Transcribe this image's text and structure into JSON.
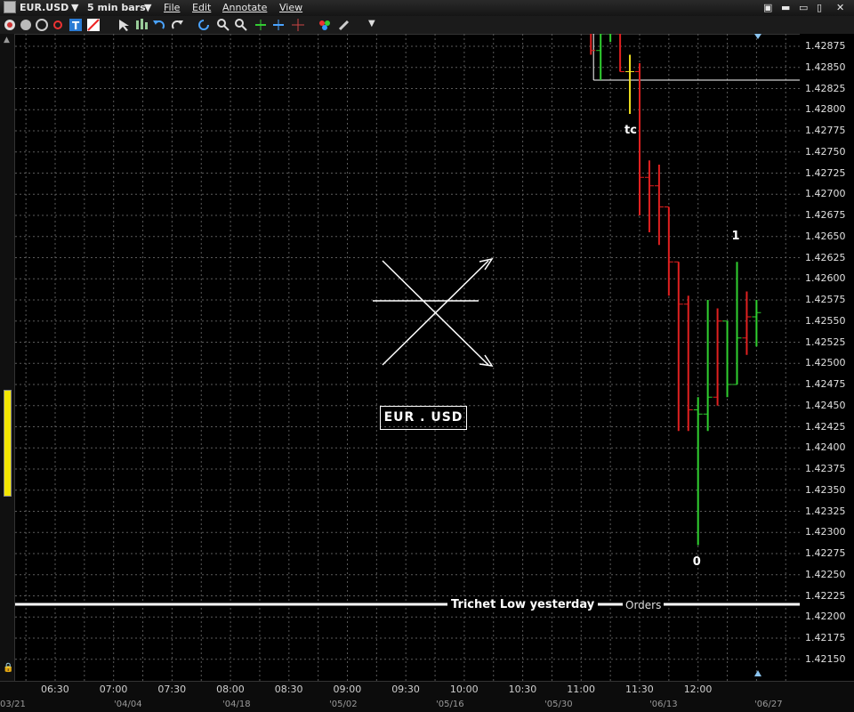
{
  "window": {
    "symbol": "EUR.USD",
    "bar_size": "5 min bars",
    "menus": [
      "File",
      "Edit",
      "Annotate",
      "View"
    ]
  },
  "chart_data": {
    "type": "bar",
    "ylim": [
      1.4214,
      1.42895
    ],
    "y_ticks": [
      "1.42875",
      "1.42850",
      "1.42825",
      "1.42800",
      "1.42775",
      "1.42750",
      "1.42725",
      "1.42700",
      "1.42675",
      "1.42650",
      "1.42625",
      "1.42600",
      "1.42575",
      "1.42550",
      "1.42525",
      "1.42500",
      "1.42475",
      "1.42450",
      "1.42425",
      "1.42400",
      "1.42375",
      "1.42350",
      "1.42325",
      "1.42300",
      "1.42275",
      "1.42250",
      "1.42225",
      "1.42200",
      "1.42175",
      "1.42150"
    ],
    "x_ticks": [
      "06:30",
      "07:00",
      "07:30",
      "08:00",
      "08:30",
      "09:00",
      "09:30",
      "10:00",
      "10:30",
      "11:00",
      "11:30",
      "12:00"
    ],
    "range_labels": [
      "03/21",
      "'04/04",
      "'04/18",
      "'05/02",
      "'05/16",
      "'05/30",
      "'06/13",
      "'06/27"
    ],
    "ohlc_bars": [
      {
        "time": "11:05",
        "open": 1.429,
        "high": 1.429,
        "low": 1.42865,
        "close": 1.4287,
        "color": "#e02020"
      },
      {
        "time": "11:10",
        "open": 1.4287,
        "high": 1.429,
        "low": 1.42835,
        "close": 1.4289,
        "color": "#30d030"
      },
      {
        "time": "11:15",
        "open": 1.4289,
        "high": 1.429,
        "low": 1.4288,
        "close": 1.42895,
        "color": "#30d030"
      },
      {
        "time": "11:20",
        "open": 1.4289,
        "high": 1.429,
        "low": 1.42845,
        "close": 1.42845,
        "color": "#e02020"
      },
      {
        "time": "11:25",
        "open": 1.42845,
        "high": 1.42865,
        "low": 1.42795,
        "close": 1.42845,
        "color": "#f0e020"
      },
      {
        "time": "11:30",
        "open": 1.42845,
        "high": 1.42855,
        "low": 1.42675,
        "close": 1.4272,
        "color": "#e02020"
      },
      {
        "time": "11:35",
        "open": 1.4272,
        "high": 1.4274,
        "low": 1.42655,
        "close": 1.4271,
        "color": "#e02020"
      },
      {
        "time": "11:40",
        "open": 1.4271,
        "high": 1.42735,
        "low": 1.4264,
        "close": 1.42685,
        "color": "#e02020"
      },
      {
        "time": "11:45",
        "open": 1.42685,
        "high": 1.4268,
        "low": 1.4258,
        "close": 1.4262,
        "color": "#e02020"
      },
      {
        "time": "11:50",
        "open": 1.4262,
        "high": 1.4258,
        "low": 1.4242,
        "close": 1.4257,
        "color": "#e02020"
      },
      {
        "time": "11:55",
        "open": 1.4257,
        "high": 1.4258,
        "low": 1.4242,
        "close": 1.42445,
        "color": "#e02020"
      },
      {
        "time": "12:00",
        "open": 1.42445,
        "high": 1.4246,
        "low": 1.42285,
        "close": 1.4244,
        "color": "#30d030"
      },
      {
        "time": "12:05",
        "open": 1.4244,
        "high": 1.42575,
        "low": 1.4242,
        "close": 1.4246,
        "color": "#30d030"
      },
      {
        "time": "12:10",
        "open": 1.4246,
        "high": 1.42565,
        "low": 1.4245,
        "close": 1.4255,
        "color": "#e02020"
      },
      {
        "time": "12:15",
        "open": 1.4255,
        "high": 1.4253,
        "low": 1.4246,
        "close": 1.42475,
        "color": "#30d030"
      },
      {
        "time": "12:20",
        "open": 1.42475,
        "high": 1.4262,
        "low": 1.42525,
        "close": 1.4253,
        "color": "#30d030"
      },
      {
        "time": "12:25",
        "open": 1.4253,
        "high": 1.42585,
        "low": 1.4251,
        "close": 1.42555,
        "color": "#e02020"
      },
      {
        "time": "12:30",
        "open": 1.42555,
        "high": 1.42575,
        "low": 1.4252,
        "close": 1.4256,
        "color": "#30d030"
      }
    ],
    "annotations": [
      {
        "text": "tc",
        "time": "11:25",
        "price": 1.42775
      },
      {
        "text": "1",
        "time": "12:20",
        "price": 1.4265
      },
      {
        "text": "0",
        "time": "12:00",
        "price": 1.42265
      }
    ],
    "lines": [
      {
        "label": "",
        "price": 1.42835,
        "from_time": "11:10"
      },
      {
        "label": "Trichet Low yesterday",
        "price": 1.42215
      }
    ],
    "orders_label": "Orders",
    "symbol_box": "EUR . USD",
    "grid": true
  }
}
